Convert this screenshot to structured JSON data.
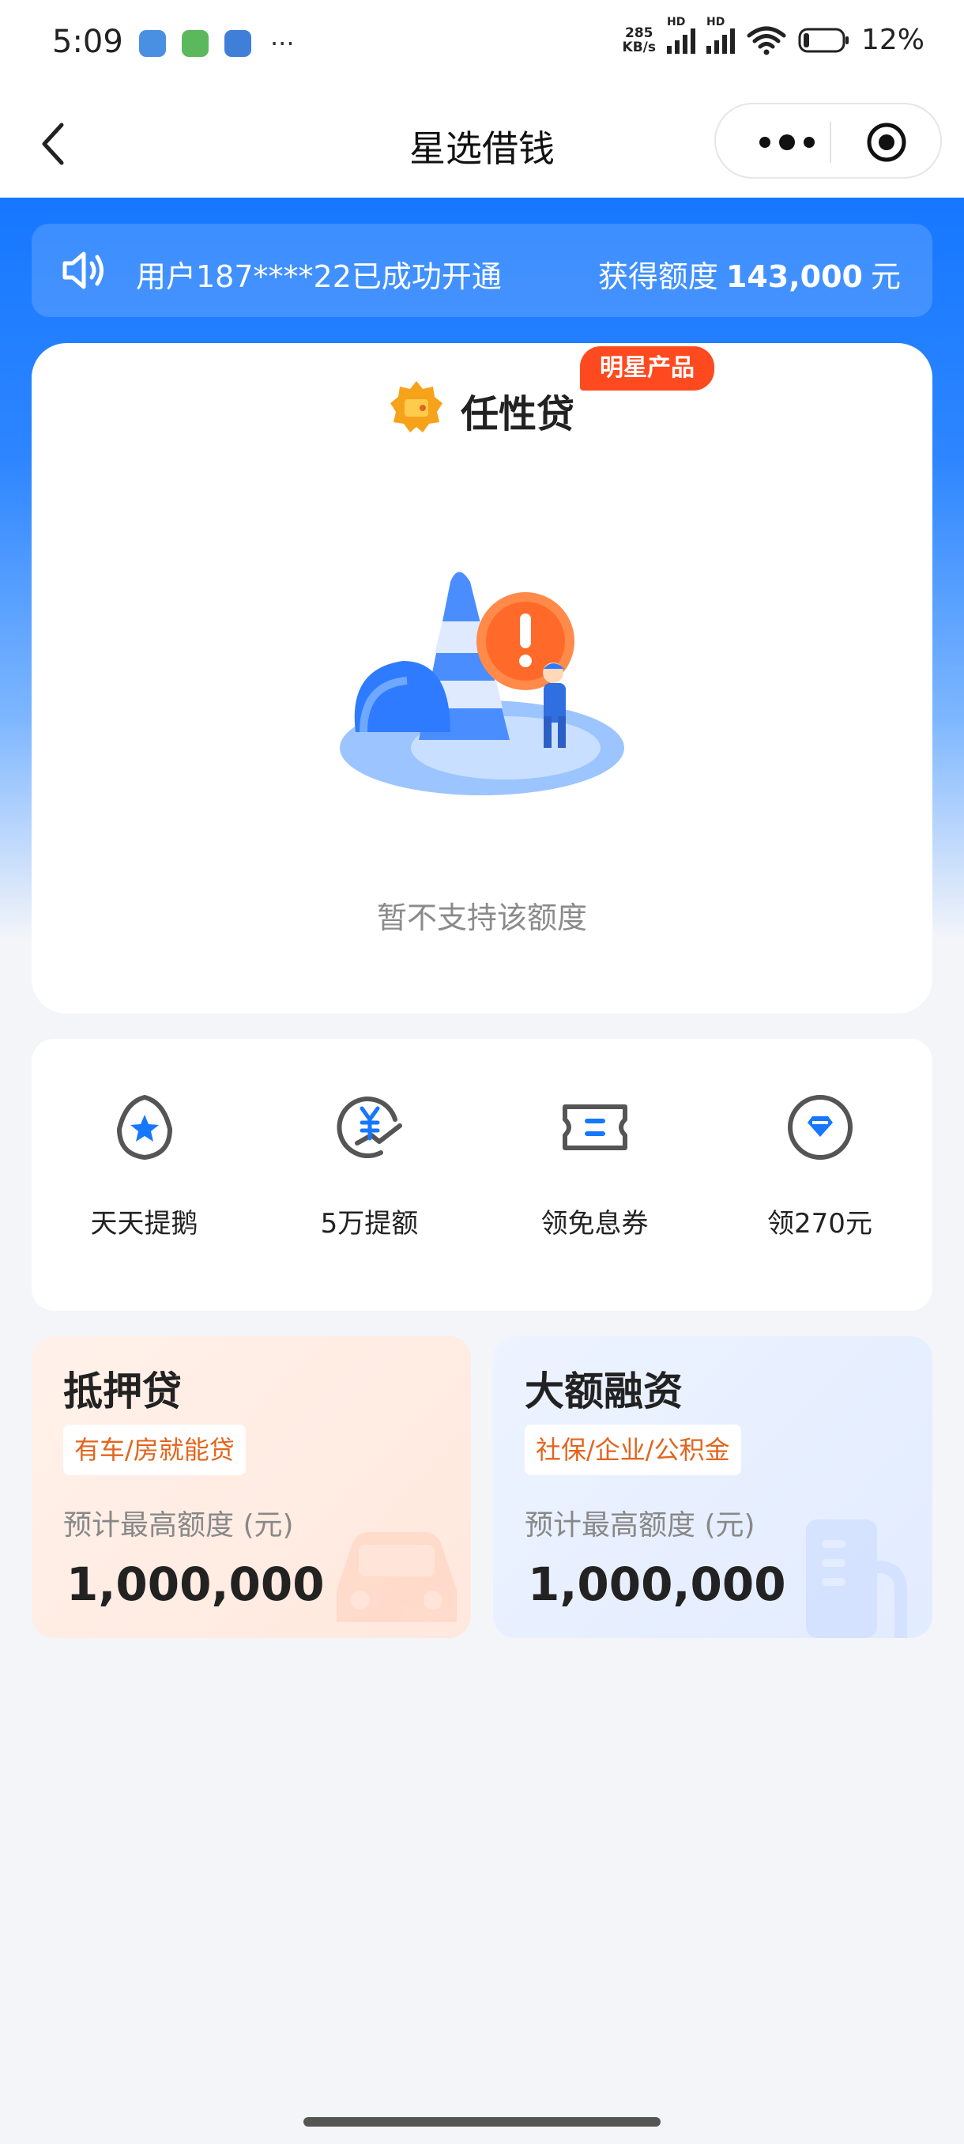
{
  "status_bar": {
    "time": "5:09",
    "more": "···",
    "net_speed_value": "285",
    "net_speed_unit": "KB/s",
    "hd1": "HD",
    "hd2": "HD",
    "battery": "12%"
  },
  "nav": {
    "title": "星选借钱"
  },
  "notice": {
    "text": "用户187****22已成功开通",
    "amount_label": "获得额度",
    "amount_value": "143,000",
    "amount_unit": "元"
  },
  "product": {
    "name": "任性贷",
    "badge": "明星产品",
    "empty_text": "暂不支持该额度"
  },
  "quick_actions": [
    {
      "label": "天天提鹅",
      "icon": "star-shield-icon"
    },
    {
      "label": "5万提额",
      "icon": "yuan-chart-icon"
    },
    {
      "label": "领免息券",
      "icon": "coupon-icon"
    },
    {
      "label": "领270元",
      "icon": "diamond-icon"
    }
  ],
  "loans": [
    {
      "title": "抵押贷",
      "tag": "有车/房就能贷",
      "subtitle": "预计最高额度 (元)",
      "amount": "1,000,000",
      "icon": "car-icon"
    },
    {
      "title": "大额融资",
      "tag": "社保/企业/公积金",
      "subtitle": "预计最高额度 (元)",
      "amount": "1,000,000",
      "icon": "building-icon"
    }
  ],
  "colors": {
    "brand_blue": "#1677ff",
    "badge_red": "#ff4a1f",
    "tag_orange": "#e2651e"
  }
}
